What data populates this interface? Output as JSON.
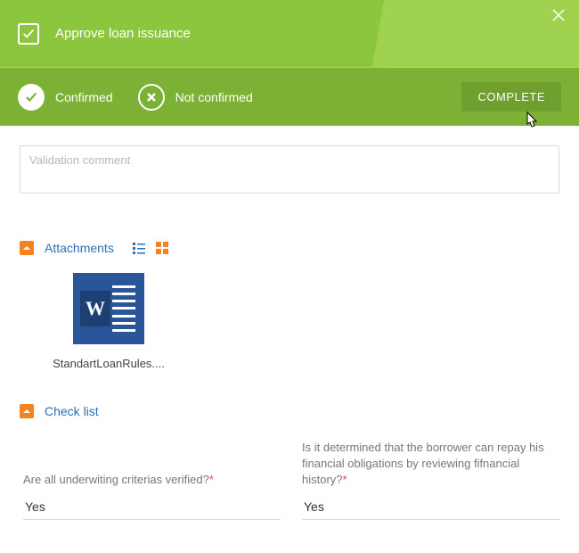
{
  "header": {
    "title": "Approve loan issuance"
  },
  "actions": {
    "confirmed_label": "Confirmed",
    "not_confirmed_label": "Not confirmed",
    "complete_label": "COMPLETE"
  },
  "comment": {
    "placeholder": "Validation comment",
    "value": ""
  },
  "attachments": {
    "title": "Attachments",
    "items": [
      {
        "icon": "word-doc-icon",
        "name": "StandartLoanRules...."
      }
    ]
  },
  "checklist": {
    "title": "Check list",
    "fields": [
      {
        "label": "Are all underwiting criterias verified?",
        "required": true,
        "value": "Yes"
      },
      {
        "label": "Is it determined that the borrower can repay his financial obligations by reviewing fifnancial history?",
        "required": true,
        "value": "Yes"
      }
    ]
  }
}
